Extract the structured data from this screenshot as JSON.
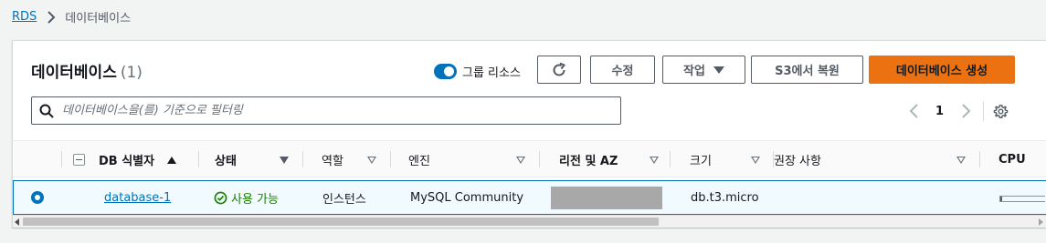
{
  "breadcrumb": {
    "root": "RDS",
    "current": "데이터베이스"
  },
  "panel": {
    "title": "데이터베이스",
    "count": "(1)"
  },
  "toolbar": {
    "group_toggle_label": "그룹 리소스",
    "group_toggle_on": true,
    "refresh_icon": "refresh-icon",
    "modify_label": "수정",
    "actions_label": "작업",
    "restore_s3_label": "S3에서 복원",
    "create_label": "데이터베이스 생성"
  },
  "search": {
    "placeholder": "데이터베이스을(를) 기준으로 필터링"
  },
  "pagination": {
    "current_page": "1"
  },
  "table": {
    "columns": {
      "db_id": "DB 식별자",
      "status": "상태",
      "role": "역할",
      "engine": "엔진",
      "region_az": "리전 및 AZ",
      "size": "크기",
      "recommendations": "권장 사항",
      "cpu": "CPU"
    },
    "rows": [
      {
        "selected": true,
        "db_id": "database-1",
        "status": "사용 가능",
        "role": "인스턴스",
        "engine": "MySQL Community",
        "region_az": "",
        "size": "db.t3.micro",
        "recommendations": "",
        "cpu_fraction": 0.02
      }
    ]
  },
  "colors": {
    "accent": "#0073bb",
    "primary_button": "#ec7211",
    "status_ok": "#1d8102",
    "selected_row_bg": "#f1faff"
  }
}
